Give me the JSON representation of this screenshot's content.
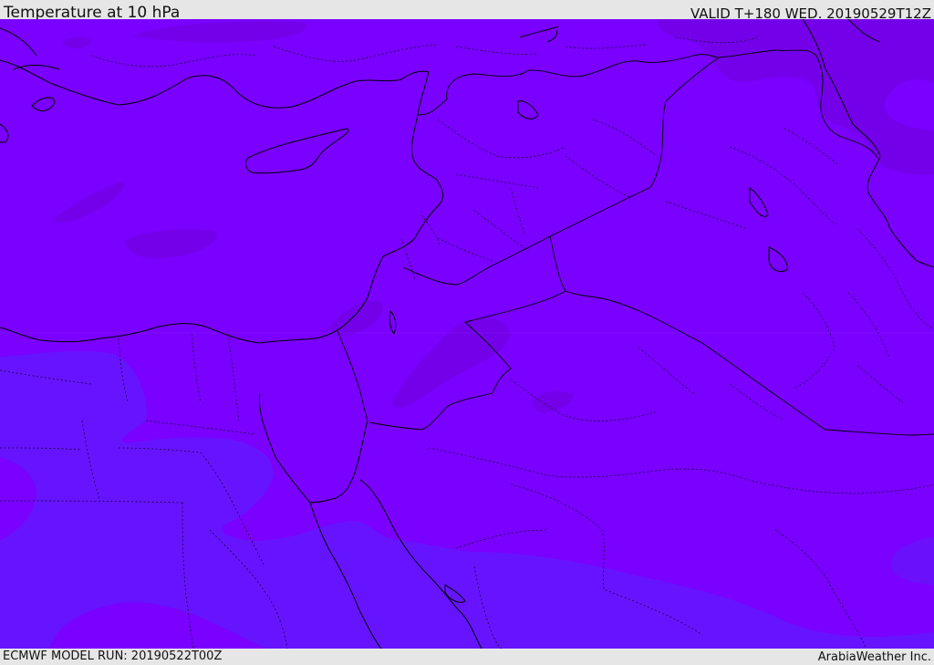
{
  "header": {
    "title": "Temperature at 10 hPa",
    "valid_time": "VALID T+180 WED. 20190529T12Z"
  },
  "footer": {
    "model_run": "ECMWF MODEL RUN: 20190522T00Z",
    "credit": "ArabiaWeather Inc."
  },
  "map": {
    "colors": {
      "main_field": "#7a00ff",
      "warmer_patch": "#7400ea",
      "cooler_band": "#6614ff",
      "cooler_band_2": "#6a10fb",
      "border_line": "#000000"
    }
  }
}
